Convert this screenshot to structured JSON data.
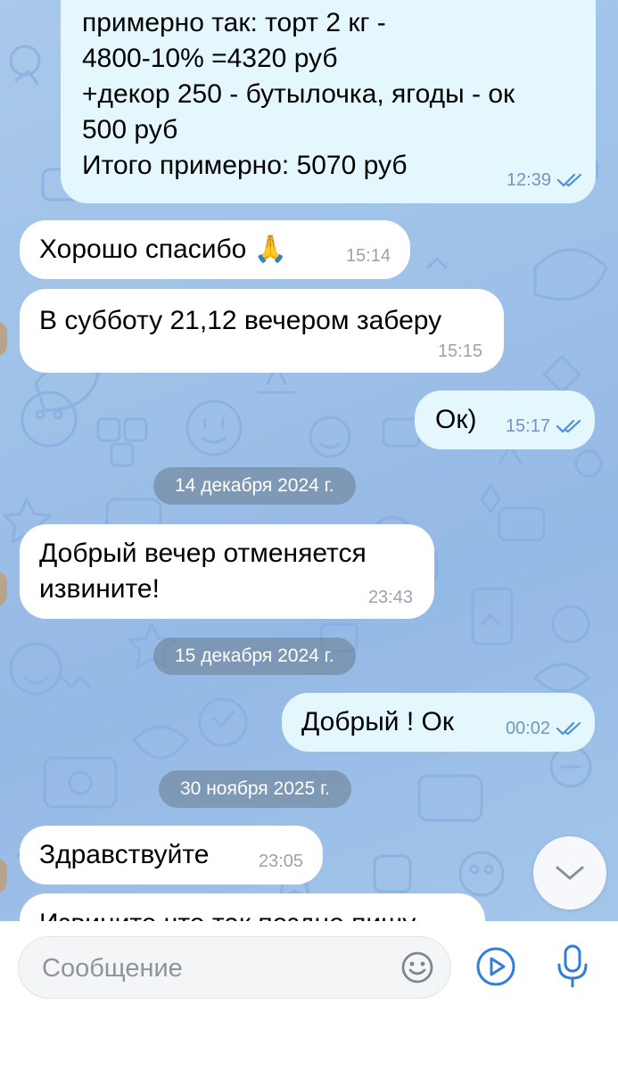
{
  "messages": [
    {
      "type": "outgoing",
      "text": "примерно так: торт 2 кг -\n4800-10% =4320 руб\n+декор 250 - бутылочка, ягоды - ок\n500 руб\nИтого примерно: 5070 руб",
      "time": "12:39",
      "read": true
    },
    {
      "type": "incoming",
      "text": "Хорошо спасибо 🙏",
      "time": "15:14"
    },
    {
      "type": "incoming",
      "text": "В субботу 21,12 вечером заберу",
      "time": "15:15"
    },
    {
      "type": "outgoing",
      "text": "Ок)",
      "time": "15:17",
      "read": true
    },
    {
      "type": "date",
      "text": "14 декабря 2024 г."
    },
    {
      "type": "incoming",
      "text": "Добрый вечер отменяется\nизвините!",
      "time": "23:43"
    },
    {
      "type": "date",
      "text": "15 декабря 2024 г."
    },
    {
      "type": "outgoing",
      "text": "Добрый ! Ок",
      "time": "00:02",
      "read": true
    },
    {
      "type": "date",
      "text": "30 ноября 2025 г."
    },
    {
      "type": "incoming",
      "text": "Здравствуйте",
      "time": "23:05"
    },
    {
      "type": "incoming",
      "text": "Извините что так поздно пишу",
      "time": ""
    }
  ],
  "composer": {
    "placeholder": "Сообщение"
  },
  "icons": {
    "scroll_down": "chevron-down-icon",
    "emoji": "emoji-icon",
    "attach": "video-message-icon",
    "mic": "microphone-icon"
  },
  "colors": {
    "wallpaper": "#9fc2e8",
    "incoming_bubble": "#ffffff",
    "outgoing_bubble": "#e3f7fd",
    "accent": "#2f7fd6"
  }
}
